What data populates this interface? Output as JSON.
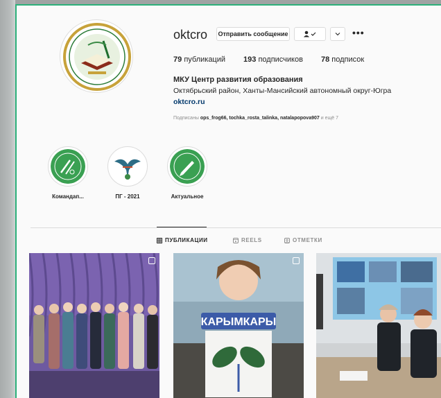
{
  "profile": {
    "username": "oktcro",
    "message_button": "Отправить сообщение",
    "follow_icon": "person-check-icon",
    "more_icon": "•••",
    "stats": {
      "posts_count": "79",
      "posts_label": "публикаций",
      "followers_count": "193",
      "followers_label": "подписчиков",
      "following_count": "78",
      "following_label": "подписок"
    },
    "full_name": "МКУ Центр развития образования",
    "bio": "Октябрьский район, Ханты-Мансийский автономный округ-Югра",
    "link": "oktcro.ru",
    "followed_by_prefix": "Подписаны",
    "followed_by_users": "ops_frog66, tochka_rosta_talinka, natalapopova907",
    "followed_by_suffix": "и ещё 7"
  },
  "highlights": [
    {
      "label": "Командап..."
    },
    {
      "label": "ПГ - 2021"
    },
    {
      "label": "Актуальное"
    }
  ],
  "tabs": [
    {
      "label": "ПУБЛИКАЦИИ",
      "icon": "grid-icon",
      "active": true
    },
    {
      "label": "REELS",
      "icon": "reels-icon",
      "active": false
    },
    {
      "label": "ОТМЕТКИ",
      "icon": "tag-icon",
      "active": false
    }
  ],
  "posts": [
    {
      "kind": "group-photo"
    },
    {
      "kind": "child-craft",
      "caption": "КАРЫМКАРЫ"
    },
    {
      "kind": "meeting-photo"
    }
  ],
  "colors": {
    "accent_green": "#2bb07a",
    "link_blue": "#00376b",
    "muted": "#8e8e8e"
  }
}
